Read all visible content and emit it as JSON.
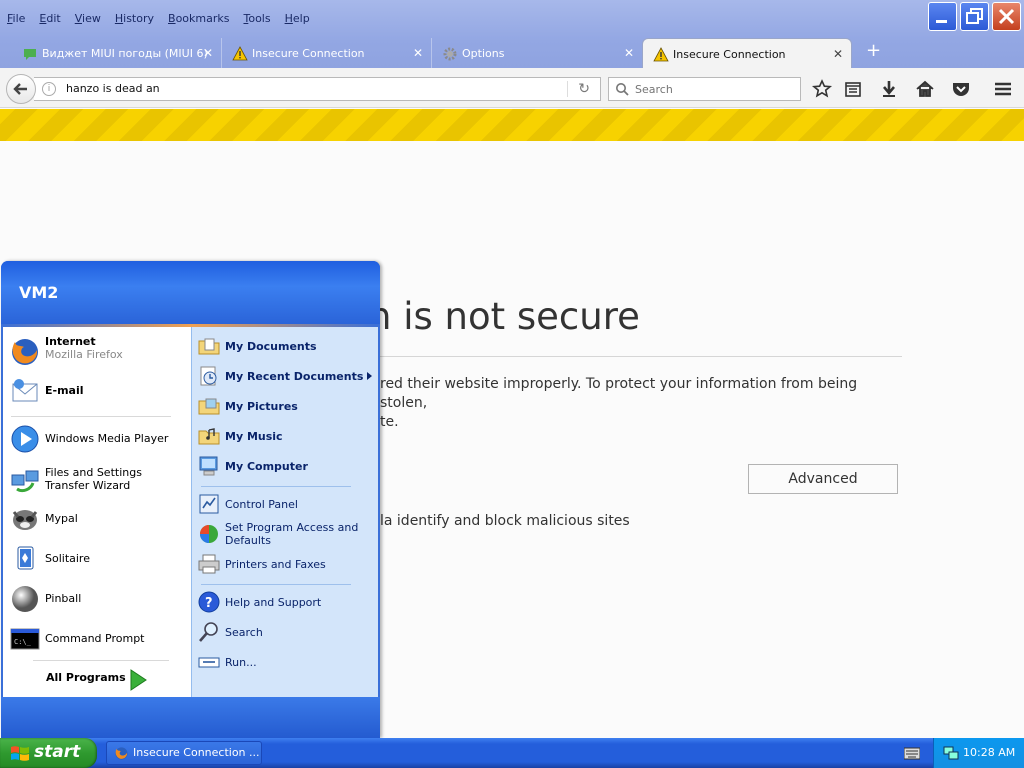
{
  "browser": {
    "menu": [
      {
        "label": "File",
        "key": "F",
        "rest": "ile"
      },
      {
        "label": "Edit",
        "key": "E",
        "rest": "dit"
      },
      {
        "label": "View",
        "key": "V",
        "rest": "iew"
      },
      {
        "label": "History",
        "key": "H",
        "rest": "istory"
      },
      {
        "label": "Bookmarks",
        "key": "B",
        "rest": "ookmarks"
      },
      {
        "label": "Tools",
        "key": "T",
        "rest": "ools"
      },
      {
        "label": "Help",
        "key": "H",
        "rest": "elp"
      }
    ],
    "tabs": [
      {
        "label": "Виджет MIUI погоды (MIUI 6)",
        "icon": "chat-bubble-icon"
      },
      {
        "label": "Insecure Connection",
        "icon": "warning-icon"
      },
      {
        "label": "Options",
        "icon": "gear-icon"
      },
      {
        "label": "Insecure Connection",
        "icon": "warning-icon"
      }
    ],
    "active_tab": 3,
    "url": "hanzo is dead an",
    "search_placeholder": "Search",
    "icons": [
      "back-arrow-icon",
      "info-icon",
      "reload-icon",
      "search-icon",
      "bookmark-star-icon",
      "reading-list-icon",
      "download-icon",
      "home-icon",
      "pocket-icon",
      "menu-icon"
    ]
  },
  "page": {
    "title": "n is not secure",
    "text_line1": "red their website improperly. To protect your information from being stolen,",
    "text_line2": "te.",
    "advanced_button": "Advanced",
    "report_text": "la identify and block malicious sites"
  },
  "start_menu": {
    "user": "VM2",
    "pinned": [
      {
        "label": "Internet",
        "sub": "Mozilla Firefox",
        "icon": "firefox-icon"
      },
      {
        "label": "E-mail",
        "icon": "email-icon"
      }
    ],
    "recent": [
      {
        "label": "Windows Media Player",
        "icon": "media-player-icon"
      },
      {
        "label": "Files and Settings Transfer Wizard",
        "icon": "transfer-wizard-icon"
      },
      {
        "label": "Mypal",
        "icon": "mypal-raccoon-icon"
      },
      {
        "label": "Solitaire",
        "icon": "solitaire-icon"
      },
      {
        "label": "Pinball",
        "icon": "pinball-icon"
      },
      {
        "label": "Command Prompt",
        "icon": "command-prompt-icon"
      }
    ],
    "all_programs": "All Programs",
    "places": [
      {
        "label": "My Documents",
        "icon": "folder-documents-icon"
      },
      {
        "label": "My Recent Documents",
        "icon": "recent-documents-icon"
      },
      {
        "label": "My Pictures",
        "icon": "folder-pictures-icon"
      },
      {
        "label": "My Music",
        "icon": "folder-music-icon"
      },
      {
        "label": "My Computer",
        "icon": "computer-icon"
      }
    ],
    "system": [
      {
        "label": "Control Panel",
        "icon": "control-panel-icon"
      },
      {
        "label": "Set Program Access and Defaults",
        "icon": "program-defaults-icon"
      },
      {
        "label": "Printers and Faxes",
        "icon": "printer-icon"
      }
    ],
    "help": [
      {
        "label": "Help and Support",
        "icon": "help-icon"
      },
      {
        "label": "Search",
        "icon": "search-icon"
      },
      {
        "label": "Run...",
        "icon": "run-icon"
      }
    ]
  },
  "taskbar": {
    "start_label": "start",
    "task_label": "Insecure Connection ...",
    "clock": "10:28 AM"
  },
  "colors": {
    "xp_blue": "#245edb",
    "start_green": "#2f9a2f",
    "hazard_yellow": "#f7d200",
    "tray_blue": "#1490e2"
  }
}
